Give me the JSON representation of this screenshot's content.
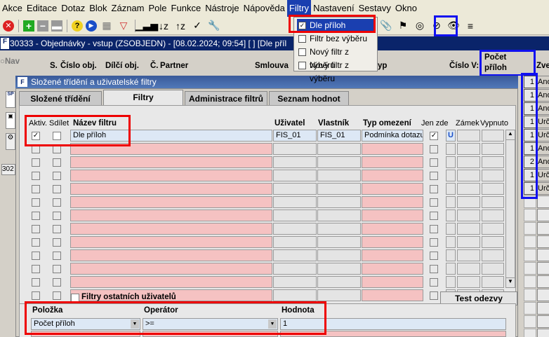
{
  "menu": [
    "Akce",
    "Editace",
    "Dotaz",
    "Blok",
    "Záznam",
    "Pole",
    "Funkce",
    "Nástroje",
    "Nápověda",
    "Filtry",
    "Nastavení",
    "Sestavy",
    "Okno"
  ],
  "window_title": "30333 - Objednávky - vstup (ZSOBJEDN) - [08.02.2024; 09:54] [ ] [Dle příl",
  "filter_menu": [
    {
      "label": "Dle příloh",
      "checked": true
    },
    {
      "label": "Filtr bez výběru",
      "checked": false
    },
    {
      "label": "Nový filtr z výběru",
      "checked": false
    },
    {
      "label": "Nový filtr z výběru",
      "checked": false
    }
  ],
  "bg_headers": {
    "nav": "Nav",
    "s": "S.",
    "cislo_obj": "Číslo obj.",
    "dilci_obj": "Dílčí obj.",
    "c": "Č.",
    "partner": "Partner",
    "smlouva": "Smlouva",
    "typ": "yp",
    "cislo_v": "Číslo V:",
    "pocet": "Počet",
    "priloh": "příloh",
    "zve": "Zve"
  },
  "dialog": {
    "title": "Složené třídění a uživatelské filtry",
    "tabs": [
      "Složené třídění",
      "Filtry",
      "Administrace filtrů",
      "Seznam hodnot"
    ],
    "active_tab": 1,
    "headers": {
      "aktiv": "Aktiv.",
      "sdilet": "Sdílet",
      "nazev": "Název filtru",
      "uzivatel": "Uživatel",
      "vlastnik": "Vlastník",
      "typ": "Typ omezení",
      "jen_zde": "Jen zde",
      "zamek": "Zámek",
      "vypnuto": "Vypnuto"
    },
    "row1": {
      "nazev": "Dle příloh",
      "uzivatel": "FIS_01",
      "vlastnik": "FIS_01",
      "typ": "Podmínka dotazu",
      "zamek": "U"
    },
    "other_users_label": "Filtry ostatních uživatelů",
    "test_button": "Test odezvy",
    "cond_headers": {
      "polozka": "Položka",
      "operator": "Operátor",
      "hodnota": "Hodnota"
    },
    "cond_row": {
      "polozka": "Počet příloh",
      "operator": ">=",
      "hodnota": "1"
    }
  },
  "right_col": {
    "counts": [
      "1",
      "1",
      "1",
      "1",
      "1",
      "1",
      "2",
      "1",
      "1"
    ],
    "zve": [
      "Ano",
      "Ano",
      "Ano",
      "Urč",
      "Urč",
      "Ano",
      "Ano",
      "Urč",
      "Urč"
    ]
  },
  "left_side": {
    "code": "302",
    "sp": "SP"
  }
}
